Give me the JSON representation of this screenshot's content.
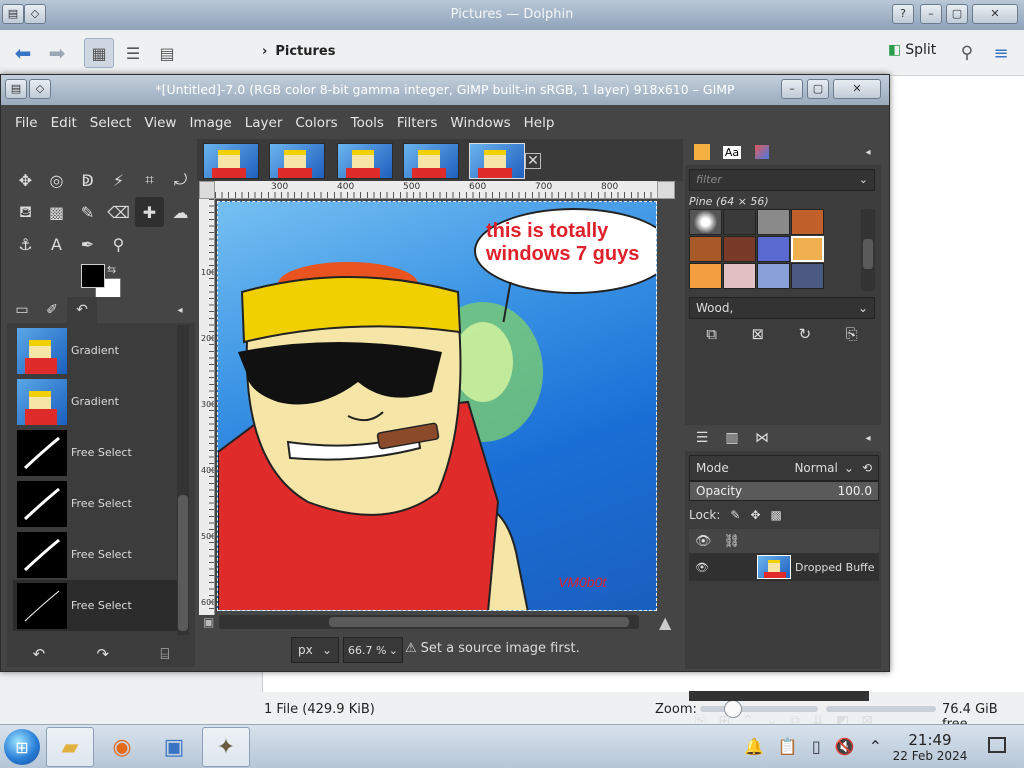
{
  "dolphin": {
    "title": "Pictures — Dolphin",
    "breadcrumb": "Pictures",
    "split_label": "Split",
    "status_files": "1 File (429.9 KiB)",
    "zoom_label": "Zoom:",
    "free_space": "76.4 GiB free"
  },
  "gimp": {
    "title": "*[Untitled]-7.0 (RGB color 8-bit gamma integer, GIMP built-in sRGB, 1 layer) 918x610 – GIMP",
    "menu": [
      "File",
      "Edit",
      "Select",
      "View",
      "Image",
      "Layer",
      "Colors",
      "Tools",
      "Filters",
      "Windows",
      "Help"
    ],
    "history": [
      {
        "label": "Gradient",
        "thumb": "image"
      },
      {
        "label": "Gradient",
        "thumb": "image"
      },
      {
        "label": "Free Select",
        "thumb": "mask"
      },
      {
        "label": "Free Select",
        "thumb": "mask"
      },
      {
        "label": "Free Select",
        "thumb": "mask"
      },
      {
        "label": "Free Select",
        "thumb": "mask"
      }
    ],
    "ruler_top_labels": [
      "300",
      "400",
      "500",
      "600",
      "700",
      "800"
    ],
    "ruler_left_labels": [
      "100",
      "200",
      "300",
      "400",
      "500",
      "600"
    ],
    "canvas": {
      "bubble_text": "this is totally windows 7 guys",
      "signature": "VM0b0t"
    },
    "unit": "px",
    "zoom": "66.7 %",
    "status_message": "Set a source image first.",
    "brushes": {
      "filter_placeholder": "filter",
      "pattern_name": "Pine (64 × 56)",
      "tag": "Wood,"
    },
    "layers": {
      "mode_label": "Mode",
      "mode_value": "Normal",
      "opacity_label": "Opacity",
      "opacity_value": "100.0",
      "lock_label": "Lock:",
      "layer_name": "Dropped Buffe"
    }
  },
  "taskbar": {
    "time": "21:49",
    "date": "22 Feb 2024"
  },
  "colors": {
    "fg": "#000000",
    "bg": "#ffffff",
    "accent_red": "#e0202a",
    "gimp_dark": "#454545"
  }
}
